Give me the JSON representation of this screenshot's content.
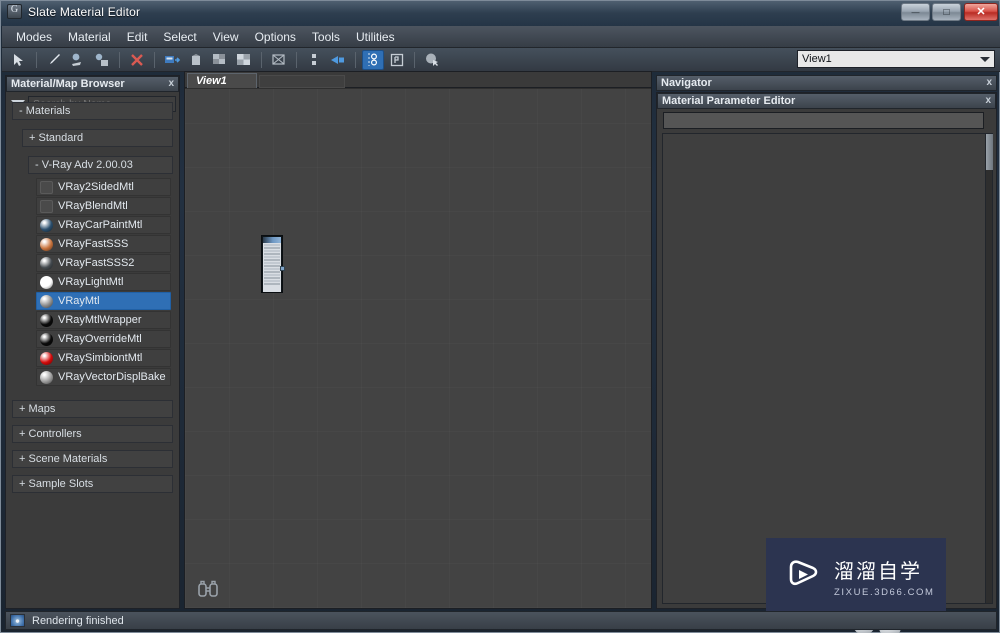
{
  "window": {
    "title": "Slate Material Editor",
    "app_icon": "slate-app-icon",
    "minimize_label": "—",
    "maximize_label": "□",
    "close_label": "✕"
  },
  "menubar": {
    "items": [
      {
        "label": "Modes"
      },
      {
        "label": "Material"
      },
      {
        "label": "Edit"
      },
      {
        "label": "Select"
      },
      {
        "label": "View"
      },
      {
        "label": "Options"
      },
      {
        "label": "Tools"
      },
      {
        "label": "Utilities"
      }
    ]
  },
  "toolbar": {
    "buttons": [
      {
        "name": "select-arrow-icon",
        "glyph": "➤",
        "active": false
      },
      {
        "name": "pick-material-eyedropper-icon",
        "glyph": "✐",
        "active": false
      },
      {
        "name": "assign-material-to-selection-icon",
        "glyph": "◑",
        "active": false
      },
      {
        "name": "show-shaded-material-in-viewport-icon",
        "glyph": "▣",
        "active": false
      },
      {
        "name": "delete-node-icon",
        "glyph": "✕",
        "active": false
      },
      {
        "name": "put-material-to-library-icon",
        "glyph": "▤",
        "active": false
      },
      {
        "name": "move-children-icon",
        "glyph": "☲",
        "active": false
      },
      {
        "name": "show-background-icon",
        "glyph": "░",
        "active": false
      },
      {
        "name": "show-checker-background-icon",
        "glyph": "▒",
        "active": false
      },
      {
        "name": "layout-children-icon",
        "glyph": "⌧",
        "active": false
      },
      {
        "name": "lay-out-all-vertical-icon",
        "glyph": "⋮",
        "active": false
      },
      {
        "name": "move-children-node-icon",
        "glyph": "⊳",
        "active": false
      },
      {
        "name": "show-material-parameter-editor-icon",
        "glyph": "☷",
        "active": true
      },
      {
        "name": "material-id-channel-icon",
        "glyph": "▧",
        "active": false
      },
      {
        "name": "select-by-material-icon",
        "glyph": "⌾",
        "active": false
      }
    ],
    "view_selector": {
      "value": "View1",
      "icon": "chevron-down-icon"
    }
  },
  "browser": {
    "title": "Material/Map Browser",
    "close_icon": "x",
    "filter_icon": "filter-caret-icon",
    "search": {
      "placeholder": "Search by Name ...",
      "value": ""
    },
    "groups": [
      {
        "name": "materials-group",
        "expander": "-",
        "label": "Materials",
        "level": 0
      },
      {
        "name": "standard-group",
        "expander": "+",
        "label": "Standard",
        "level": 1
      },
      {
        "name": "vray-adv-group",
        "expander": "-",
        "label": "V-Ray Adv 2.00.03",
        "level": 2
      }
    ],
    "materials": [
      {
        "label": "VRay2SidedMtl",
        "swatch": "square",
        "color": "#4a4a4a",
        "selected": false
      },
      {
        "label": "VRayBlendMtl",
        "swatch": "square",
        "color": "#4a4a4a",
        "selected": false
      },
      {
        "label": "VRayCarPaintMtl",
        "swatch": "sphere",
        "color": "#2b4f6e",
        "selected": false
      },
      {
        "label": "VRayFastSSS",
        "swatch": "sphere",
        "color": "#c9733c",
        "selected": false
      },
      {
        "label": "VRayFastSSS2",
        "swatch": "sphere",
        "color": "#454b50",
        "selected": false
      },
      {
        "label": "VRayLightMtl",
        "swatch": "sphere",
        "color": "#ffffff",
        "selected": false
      },
      {
        "label": "VRayMtl",
        "swatch": "sphere",
        "color": "#8d8d8d",
        "selected": true
      },
      {
        "label": "VRayMtlWrapper",
        "swatch": "sphere",
        "color": "#0a0a0a",
        "selected": false
      },
      {
        "label": "VRayOverrideMtl",
        "swatch": "sphere",
        "color": "#0a0a0a",
        "selected": false
      },
      {
        "label": "VRaySimbiontMtl",
        "swatch": "sphere",
        "color": "#d40a0a",
        "selected": false
      },
      {
        "label": "VRayVectorDisplBake",
        "swatch": "sphere",
        "color": "#9c9c9c",
        "selected": false
      }
    ],
    "sections": [
      {
        "expander": "+",
        "label": "Maps"
      },
      {
        "expander": "+",
        "label": "Controllers"
      },
      {
        "expander": "+",
        "label": "Scene Materials"
      },
      {
        "expander": "+",
        "label": "Sample Slots"
      }
    ]
  },
  "navigator": {
    "title": "Navigator",
    "close_icon": "x"
  },
  "parameter_editor": {
    "title": "Material Parameter Editor",
    "close_icon": "x",
    "name_field_value": ""
  },
  "canvas": {
    "tabs": [
      {
        "label": "View1",
        "active": true
      },
      {
        "label": "",
        "active": false
      }
    ],
    "pan_zoom_icon": "binoculars-icon",
    "node": {
      "name": "material-node",
      "title_label": "",
      "socket_count": 14
    }
  },
  "watermark": {
    "logo_icon": "play-button-logo",
    "chinese_text": "溜溜自学",
    "english_text": "ZIXUE.3D66.COM",
    "background_color": "#2c3450"
  },
  "statusbar": {
    "icon": "render-status-icon",
    "text": "Rendering finished"
  }
}
